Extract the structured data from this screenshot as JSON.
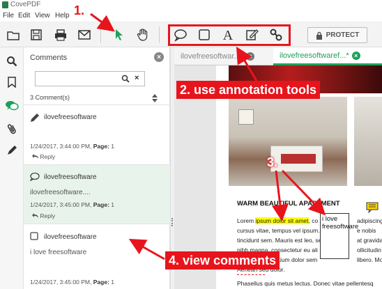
{
  "window": {
    "title": "CovePDF"
  },
  "menu": [
    "File",
    "Edit",
    "View",
    "Help"
  ],
  "toolbar": {
    "protect_label": "PROTECT",
    "icons": [
      "open-icon",
      "save-icon",
      "print-icon",
      "email-icon",
      "select-arrow-icon",
      "hand-icon",
      "comment-bubble-icon",
      "rectangle-icon",
      "text-tool-icon",
      "edit-icon",
      "link-icon"
    ]
  },
  "rail": [
    "search-icon",
    "bookmark-icon",
    "comments-icon",
    "attachment-icon",
    "signature-icon"
  ],
  "panel": {
    "title": "Comments",
    "search_value": "",
    "count_label": "3 Comment(s)",
    "reply_label": "Reply",
    "page_prefix": "Page:",
    "comments": [
      {
        "icon": "pencil-icon",
        "author": "ilovefreesoftware",
        "body": "",
        "date": "1/24/2017, 3:44:00 PM,",
        "page": "1",
        "highlighted": false
      },
      {
        "icon": "speech-bubble-icon",
        "author": "ilovefreesoftware",
        "body": "ilovefreesoftware....",
        "date": "1/24/2017, 3:45:00 PM,",
        "page": "1",
        "highlighted": true
      },
      {
        "icon": "checkbox-icon",
        "author": "ilovefreesoftware",
        "body": "i love freesoftware",
        "date": "1/24/2017, 3:45:00 PM,",
        "page": "1",
        "highlighted": false
      }
    ]
  },
  "tabs": [
    {
      "label": "ilovefreesoftwar...*",
      "active": false
    },
    {
      "label": "ilovefreesoftwaref...*",
      "active": true
    }
  ],
  "document": {
    "heading": "WARM BEAUTIFUL APARTMENT",
    "lines": [
      {
        "pre": "Lorem ",
        "hl": "ipsum dolor sit amet",
        "post": ", co",
        "tail": "adipiscing e"
      },
      {
        "pre": "cursus vitae, tempus vel ipsum. Maecenas ",
        "hl": "",
        "post": "",
        "tail": "e nobis"
      },
      {
        "pre": "tincidunt sem. Mauris est leo, sem",
        "hl": "",
        "post": "",
        "tail": "at gravida v"
      },
      {
        "pre": "nibh magna, consectetur eu ali",
        "hl": "",
        "post": "",
        "tail": "ollicitudin eg"
      },
      {
        "pre": "luctus. Cras pretium dolor sem",
        "hl": "",
        "post": "",
        "tail": "libero. Mor"
      },
      {
        "pre": "Aenean sed dolor.",
        "hl": "",
        "post": "",
        "tail": ""
      },
      {
        "pre": "Phasellus quis metus lectus. Donec vitae pellentesq",
        "hl": "",
        "post": "",
        "tail": ""
      }
    ],
    "textbox": "i love freesoftware"
  },
  "annotations": {
    "step1": "1.",
    "step2": "2. use annotation tools",
    "step3": "3.",
    "step4": "4. view comments"
  },
  "colors": {
    "accent_green": "#1fa05a",
    "annotation_red": "#e8141c",
    "highlight": "#ffff00"
  }
}
